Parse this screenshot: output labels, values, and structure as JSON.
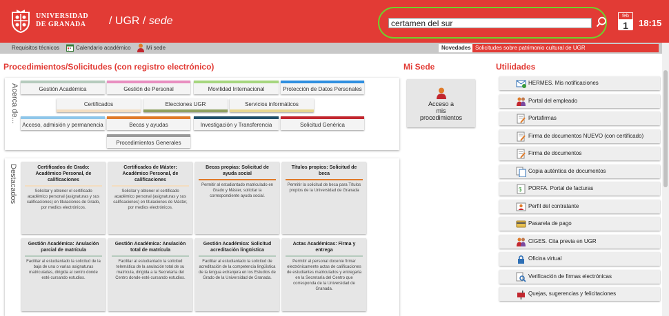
{
  "header": {
    "uni_line1": "UNIVERSIDAD",
    "uni_line2": "DE GRANADA",
    "sede_prefix": "/ UGR /",
    "sede_suffix": "sede",
    "search_value": "certamen del sur",
    "date_month": "feb",
    "date_day": "1",
    "time": "18:15"
  },
  "topbar": {
    "requisitos": "Requisitos técnicos",
    "calendario": "Calendario académico",
    "misede": "Mi sede",
    "novedades_label": "Novedades",
    "novedades_text": "Solicitudes sobre patrimonio cultural de UGR"
  },
  "sections": {
    "procedimientos": "Procedimientos/Solicitudes (con registro electrónico)",
    "misede": "Mi Sede",
    "utilidades": "Utilidades",
    "acerca": "Acerca de...",
    "destacados": "Destacados"
  },
  "categories": [
    {
      "label": "Gestión Académica",
      "color": "#b5cbbd"
    },
    {
      "label": "Gestión de Personal",
      "color": "#e88fc0"
    },
    {
      "label": "Movilidad Internacional",
      "color": "#a6d67e"
    },
    {
      "label": "Protección de Datos Personales",
      "color": "#2e8fe0"
    },
    {
      "label": "Certificados",
      "color": "#f3ddc0"
    },
    {
      "label": "Elecciones UGR",
      "color": "#8fa060"
    },
    {
      "label": "Servicios informáticos",
      "color": "#e6d690"
    },
    {
      "label": "Acceso, admisión y permanencia",
      "color": "#8ec6ea"
    },
    {
      "label": "Becas y ayudas",
      "color": "#e07a28"
    },
    {
      "label": "Investigación y Transferencia",
      "color": "#1f4f6a"
    },
    {
      "label": "Solicitud Genérica",
      "color": "#c2262e"
    },
    {
      "label": "Procedimientos Generales",
      "color": "#999999"
    }
  ],
  "cards": [
    {
      "title": "Certificados de Grado: Académico Personal, de calificaciones",
      "desc": "Solicitar y obtener el certificado académico personal (asignaturas y sus calificaciones) en titulaciones de Grado, por medios electrónicos.",
      "color": "#f3ddc0"
    },
    {
      "title": "Certificados de Máster: Académico Personal, de calificaciones",
      "desc": "Solicitar y obtener el certificado académico personal (asignaturas y sus calificaciones) en titulaciones de Máster, por medios electrónicos.",
      "color": "#f3ddc0"
    },
    {
      "title": "Becas propias: Solicitud de ayuda social",
      "desc": "Permitir al estudiantado matriculado en Grado y Máster, solicitar la correspondiente ayuda social.",
      "color": "#e07a28"
    },
    {
      "title": "Títulos propios: Solicitud de beca",
      "desc": "Permitir la solicitud de beca para Títulos propios de la Universidad de Granada",
      "color": "#e07a28"
    },
    {
      "title": "Gestión Académica: Anulación parcial de matrícula",
      "desc": "Facilitar al estudiantado la solicitud de la baja de una o varias asignaturas matriculadas, dirigida al centro donde esté cursando estudios.",
      "color": "#b5cbbd"
    },
    {
      "title": "Gestión Académica: Anulación total de matrícula",
      "desc": "Facilitar al estudiantado la solicitud telemática de la anulación total de su matrícula, dirigida a la Secretaría del Centro donde esté cursando estudios.",
      "color": "#b5cbbd"
    },
    {
      "title": "Gestión Académica: Solicitud acreditación lingüística",
      "desc": "Facilitar al estudiantado la solicitud de acreditación de la competencia lingüística de la lengua extranjera en los Estudios de Grado de la Universidad de Granada.",
      "color": "#b5cbbd"
    },
    {
      "title": "Actas Académicas: Firma y entrega",
      "desc": "Permitir al personal docente firmar electrónicamente actas de calificaciones de estudiantes matriculados y entregarla en la Secretaría del Centro que corresponda de la Universidad de Granada.",
      "color": "#b5cbbd"
    }
  ],
  "misede_box": {
    "line1": "Acceso a",
    "line2": "mis",
    "line3": "procedimientos"
  },
  "utilidades": [
    {
      "label": "HERMES. Mis notificaciones",
      "icon": "mail-check-icon"
    },
    {
      "label": "Portal del empleado",
      "icon": "people-icon"
    },
    {
      "label": "Portafirmas",
      "icon": "sign-doc-icon"
    },
    {
      "label": "Firma de documentos NUEVO (con certificado)",
      "icon": "sign-doc-icon"
    },
    {
      "label": "Firma de documentos",
      "icon": "sign-doc-icon"
    },
    {
      "label": "Copia auténtica de documentos",
      "icon": "copy-doc-icon"
    },
    {
      "label": "PORFA. Portal de facturas",
      "icon": "invoice-icon"
    },
    {
      "label": "Perfil del contratante",
      "icon": "profile-icon"
    },
    {
      "label": "Pasarela de pago",
      "icon": "payment-icon"
    },
    {
      "label": "CIGES. Cita previa en UGR",
      "icon": "people-icon"
    },
    {
      "label": "Oficina virtual",
      "icon": "lock-icon"
    },
    {
      "label": "Verificación de firmas electrónicas",
      "icon": "magnifier-doc-icon"
    },
    {
      "label": "Quejas, sugerencias y felicitaciones",
      "icon": "mailbox-icon"
    }
  ]
}
